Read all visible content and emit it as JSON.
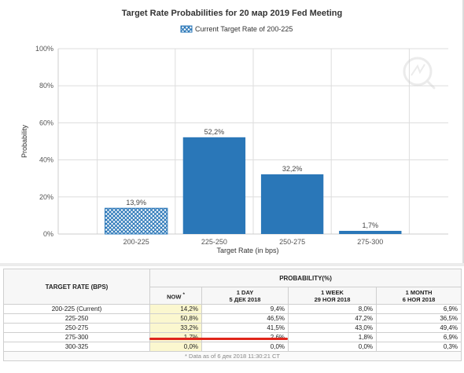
{
  "chart_data": {
    "type": "bar",
    "title": "Target Rate Probabilities for 20 мар 2019 Fed Meeting",
    "legend": {
      "label": "Current Target Rate of 200-225",
      "placement": "top-center"
    },
    "xlabel": "Target Rate (in bps)",
    "ylabel": "Probability",
    "categories": [
      "200-225",
      "225-250",
      "250-275",
      "275-300"
    ],
    "values": [
      13.9,
      52.2,
      32.2,
      1.7
    ],
    "data_labels": [
      "13,9%",
      "52,2%",
      "32,2%",
      "1,7%"
    ],
    "highlighted_category": "200-225",
    "ylim": [
      0,
      100
    ],
    "yticks": [
      0,
      20,
      40,
      60,
      80,
      100
    ],
    "ytick_labels": [
      "0%",
      "20%",
      "40%",
      "60%",
      "80%",
      "100%"
    ],
    "grid": true,
    "colors": {
      "bar": "#2a77b8",
      "highlight_bar": "#2a77b8",
      "grid": "#dddddd"
    }
  },
  "table": {
    "target_rate_header": "TARGET RATE (BPS)",
    "probability_header": "PROBABILITY(%)",
    "columns": [
      {
        "line1": "NOW",
        "marker": "*",
        "line2": ""
      },
      {
        "line1": "1 DAY",
        "line2": "5 ДЕК 2018"
      },
      {
        "line1": "1 WEEK",
        "line2": "29 НОЯ 2018"
      },
      {
        "line1": "1 MONTH",
        "line2": "6 НОЯ 2018"
      }
    ],
    "rows": [
      {
        "rate": "200-225 (Current)",
        "now": "14,2%",
        "day": "9,4%",
        "week": "8,0%",
        "month": "6,9%"
      },
      {
        "rate": "225-250",
        "now": "50,8%",
        "day": "46,5%",
        "week": "47,2%",
        "month": "36,5%"
      },
      {
        "rate": "250-275",
        "now": "33,2%",
        "day": "41,5%",
        "week": "43,0%",
        "month": "49,4%"
      },
      {
        "rate": "275-300",
        "now": "1,7%",
        "day": "2,6%",
        "week": "1,8%",
        "month": "6,9%"
      },
      {
        "rate": "300-325",
        "now": "0,0%",
        "day": "0,0%",
        "week": "0,0%",
        "month": "0,3%"
      }
    ],
    "footnote": "* Data as of 6 дек 2018 11:30:21 CT"
  },
  "colors": {
    "red_marker": "#e0251b",
    "now_cell": "#fbf7cf"
  }
}
